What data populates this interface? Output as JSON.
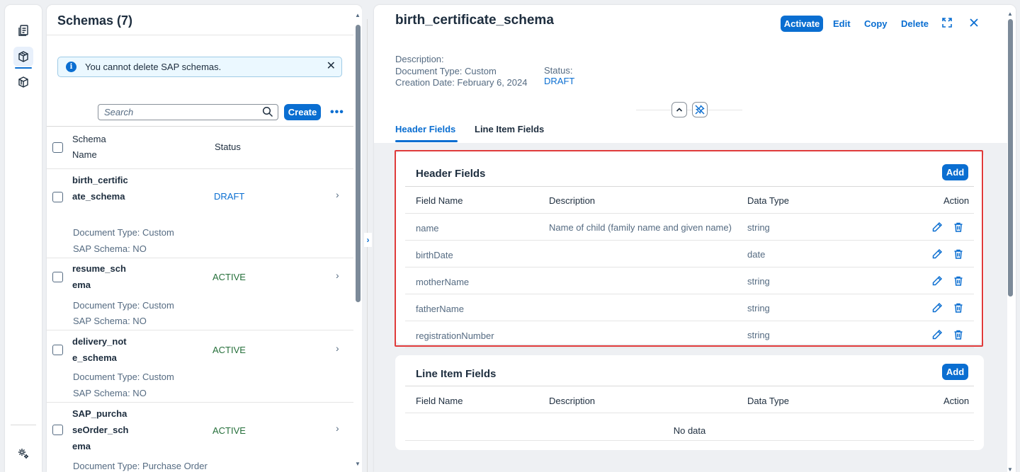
{
  "list": {
    "title": "Schemas (7)",
    "info_message": "You cannot delete SAP schemas.",
    "search_placeholder": "Search",
    "create_label": "Create",
    "more_label": "•••",
    "columns": {
      "name": "Schema Name",
      "status": "Status"
    },
    "rows": [
      {
        "name": "birth_certificate_schema",
        "doc_type": "Document Type:  Custom",
        "sap_schema": "SAP Schema:  NO",
        "status": "DRAFT"
      },
      {
        "name": "resume_schema",
        "doc_type": "Document Type:  Custom",
        "sap_schema": "SAP Schema:  NO",
        "status": "ACTIVE"
      },
      {
        "name": "delivery_note_schema",
        "doc_type": "Document Type:  Custom",
        "sap_schema": "SAP Schema:  NO",
        "status": "ACTIVE"
      },
      {
        "name": "SAP_purchaseOrder_schema",
        "doc_type": "Document Type:  Purchase Order",
        "sap_schema": "",
        "status": "ACTIVE"
      }
    ]
  },
  "detail": {
    "title": "birth_certificate_schema",
    "actions": {
      "activate": "Activate",
      "edit": "Edit",
      "copy": "Copy",
      "delete": "Delete"
    },
    "description_label": "Description:",
    "document_type": "Document Type: Custom",
    "creation_date": "Creation Date: February 6, 2024",
    "status_label": "Status:",
    "status_value": "DRAFT",
    "tabs": [
      "Header Fields",
      "Line Item Fields"
    ],
    "header_fields": {
      "title": "Header Fields",
      "add_label": "Add",
      "columns": [
        "Field Name",
        "Description",
        "Data Type",
        "Action"
      ],
      "rows": [
        {
          "field": "name",
          "description": "Name of child (family name and given name)",
          "type": "string"
        },
        {
          "field": "birthDate",
          "description": "",
          "type": "date"
        },
        {
          "field": "motherName",
          "description": "",
          "type": "string"
        },
        {
          "field": "fatherName",
          "description": "",
          "type": "string"
        },
        {
          "field": "registrationNumber",
          "description": "",
          "type": "string"
        }
      ]
    },
    "line_item_fields": {
      "title": "Line Item Fields",
      "add_label": "Add",
      "columns": [
        "Field Name",
        "Description",
        "Data Type",
        "Action"
      ],
      "empty_text": "No data"
    }
  },
  "colors": {
    "accent": "#0a6ed1",
    "active": "#256f3a",
    "highlight": "#e03a3a"
  }
}
